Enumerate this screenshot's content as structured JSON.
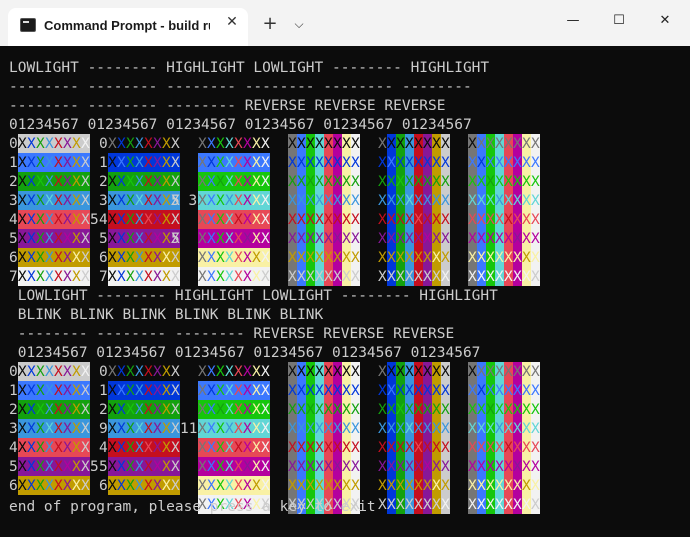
{
  "window": {
    "tab_title": "Command Prompt - build  run",
    "close_tab_glyph": "✕",
    "new_tab_glyph": "+",
    "dropdown_glyph": "⌵",
    "minimize_glyph": "—",
    "maximize_glyph": "☐",
    "close_glyph": "✕"
  },
  "colors": {
    "console_bg": "#0c0c0c",
    "console_fg": "#cccccc",
    "palette": [
      "#0c0c0c",
      "#0037da",
      "#13a10e",
      "#3a96dd",
      "#c50f1f",
      "#881798",
      "#c19c00",
      "#cccccc",
      "#767676",
      "#3b78ff",
      "#16c60c",
      "#61d6d6",
      "#e74856",
      "#b4009e",
      "#f9f1a5",
      "#f2f2f2"
    ]
  },
  "console": {
    "header1": [
      "LOWLIGHT -------- HIGHLIGHT LOWLIGHT -------- HIGHLIGHT",
      "-------- -------- -------- -------- -------- --------",
      "-------- -------- -------- REVERSE REVERSE REVERSE",
      "01234567 01234567 01234567 01234567 01234567 01234567"
    ],
    "header2": [
      " LOWLIGHT -------- HIGHLIGHT LOWLIGHT -------- HIGHLIGHT",
      " BLINK BLINK BLINK BLINK BLINK BLINK",
      " -------- -------- -------- REVERSE REVERSE REVERSE",
      " 01234567 01234567 01234567 01234567 01234567 01234567"
    ],
    "row_labels_1": [
      [
        "0",
        "1",
        "2",
        "3",
        "4",
        "5",
        "6",
        "7"
      ],
      [
        "0",
        "1",
        "2",
        "3",
        "4",
        "5",
        "6",
        "7"
      ]
    ],
    "row_labels_2": [
      [
        "0",
        "1",
        "2",
        "3",
        "4",
        "5",
        "6",
        ""
      ],
      [
        "0",
        "1",
        "2",
        "9",
        "4",
        "5",
        "6",
        ""
      ]
    ],
    "stray_text_1": [
      "5 3",
      "5",
      "5"
    ],
    "stray_text_2": [
      "11",
      "5"
    ],
    "cell_glyph": "X",
    "footer": "end of program, please press a key to exit"
  }
}
